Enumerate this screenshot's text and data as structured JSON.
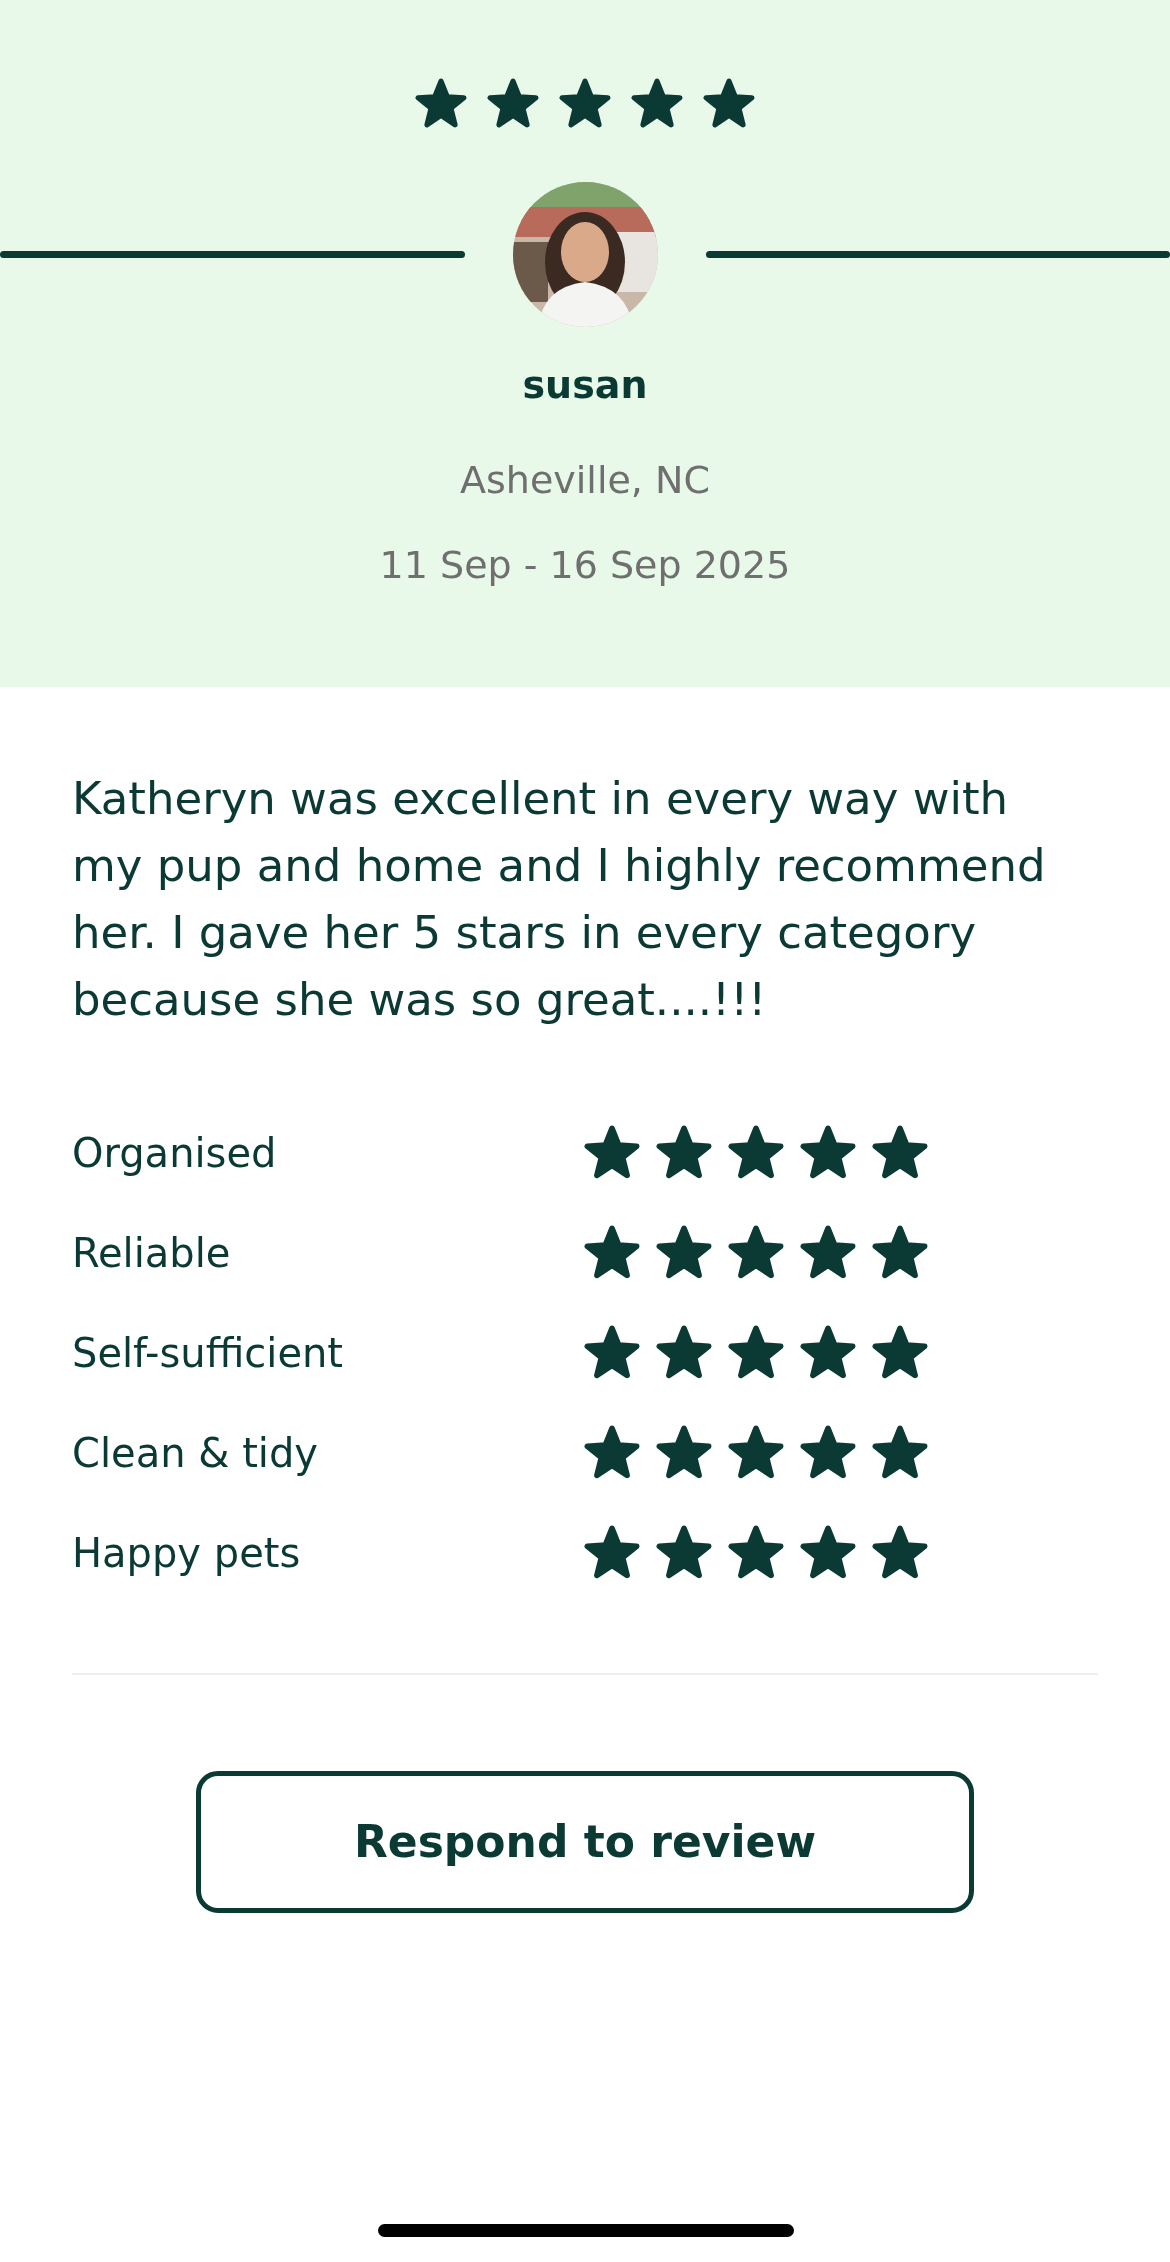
{
  "overall": {
    "stars": 5
  },
  "reviewer": {
    "name": "susan",
    "location": "Asheville, NC",
    "dates": "11 Sep - 16 Sep 2025"
  },
  "review": "Katheryn was excellent in every way with my pup and home and I highly recommend her. I gave her 5 stars in every category because she was so great....!!!",
  "ratings": [
    {
      "label": "Organised",
      "stars": 5
    },
    {
      "label": "Reliable",
      "stars": 5
    },
    {
      "label": "Self-sufficient",
      "stars": 5
    },
    {
      "label": "Clean & tidy",
      "stars": 5
    },
    {
      "label": "Happy pets",
      "stars": 5
    }
  ],
  "respond_button": "Respond to review"
}
